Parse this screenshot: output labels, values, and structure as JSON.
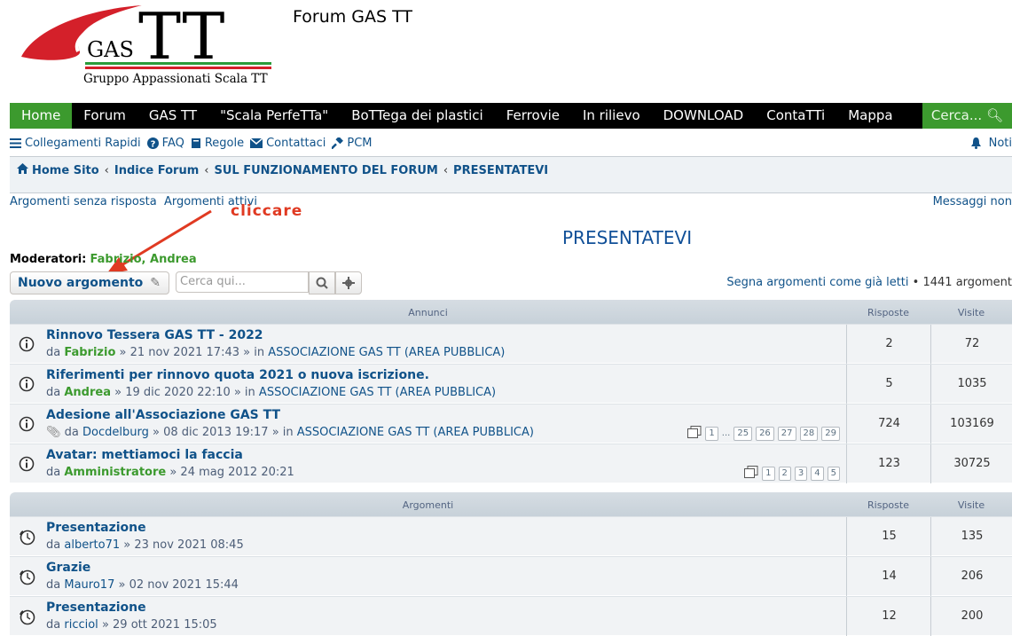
{
  "site": {
    "title": "Forum GAS TT",
    "logo_text": "GAS TT",
    "logo_sub": "Gruppo Appassionati Scala TT"
  },
  "navbar": {
    "items": [
      "Home",
      "Forum",
      "GAS TT",
      "\"Scala PerfeTTa\"",
      "BoTTega dei plastici",
      "Ferrovie",
      "In rilievo",
      "DOWNLOAD",
      "ContaTTi",
      "Mappa"
    ],
    "search": "Cerca..."
  },
  "subnav": {
    "quick": "Collegamenti Rapidi",
    "faq": "FAQ",
    "rules": "Regole",
    "contact": "Contattaci",
    "pcm": "PCM",
    "notifications": "Noti"
  },
  "breadcrumb": [
    "Home Sito",
    "Indice Forum",
    "SUL FUNZIONAMENTO DEL FORUM",
    "PRESENTATEVI"
  ],
  "quicklinks": {
    "unanswered": "Argomenti senza risposta",
    "active": "Argomenti attivi",
    "right": "Messaggi non"
  },
  "annotation": "cliccare",
  "forum": {
    "title": "PRESENTATEVI",
    "moderators_label": "Moderatori:",
    "moderators": "Fabrizio, Andrea",
    "new_topic": "Nuovo argomento",
    "search_placeholder": "Cerca qui...",
    "mark_read": "Segna argomenti come già letti",
    "topic_count": "1441 argoment"
  },
  "announcements": {
    "header": "Annunci",
    "col_replies": "Risposte",
    "col_views": "Visite",
    "rows": [
      {
        "title": "Rinnovo Tessera GAS TT - 2022",
        "by": "da",
        "author": "Fabrizio",
        "date": "» 21 nov 2021 17:43 » in",
        "forum": "ASSOCIAZIONE GAS TT (AREA PUBBLICA)",
        "replies": "2",
        "views": "72"
      },
      {
        "title": "Riferimenti per rinnovo quota 2021 o nuova iscrizione.",
        "by": "da",
        "author": "Andrea",
        "date": "» 19 dic 2020 22:10 » in",
        "forum": "ASSOCIAZIONE GAS TT (AREA PUBBLICA)",
        "replies": "5",
        "views": "1035"
      },
      {
        "title": "Adesione all'Associazione GAS TT",
        "by": "da",
        "author": "Docdelburg",
        "date": "» 08 dic 2013 19:17 » in",
        "forum": "ASSOCIAZIONE GAS TT (AREA PUBBLICA)",
        "replies": "724",
        "views": "103169",
        "pages": [
          "1",
          "...",
          "25",
          "26",
          "27",
          "28",
          "29"
        ]
      },
      {
        "title": "Avatar: mettiamoci la faccia",
        "by": "da",
        "author": "Amministratore",
        "date": "» 24 mag 2012 20:21",
        "forum": "",
        "replies": "123",
        "views": "30725",
        "pages": [
          "1",
          "2",
          "3",
          "4",
          "5"
        ]
      }
    ]
  },
  "topics": {
    "header": "Argomenti",
    "col_replies": "Risposte",
    "col_views": "Visite",
    "rows": [
      {
        "title": "Presentazione",
        "by": "da",
        "author": "alberto71",
        "date": "» 23 nov 2021 08:45",
        "replies": "15",
        "views": "135"
      },
      {
        "title": "Grazie",
        "by": "da",
        "author": "Mauro17",
        "date": "» 02 nov 2021 15:44",
        "replies": "14",
        "views": "206"
      },
      {
        "title": "Presentazione",
        "by": "da",
        "author": "ricciol",
        "date": "» 29 ott 2021 15:05",
        "replies": "12",
        "views": "200"
      }
    ]
  },
  "colors": {
    "nav_green": "#3c9a2e",
    "link": "#105289",
    "accent_red": "#e03a22"
  }
}
